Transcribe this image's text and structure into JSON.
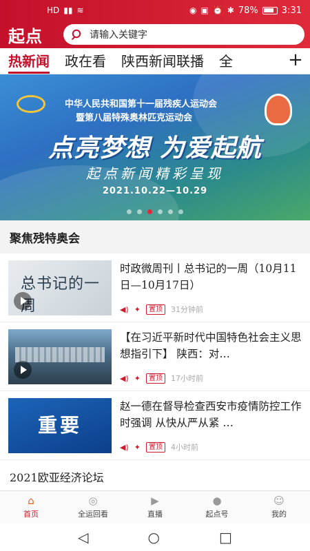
{
  "status_bar": {
    "left_icons": [
      "hd-icon",
      "signal-icon",
      "wifi-icon"
    ],
    "battery": "78%",
    "time": "3:31"
  },
  "app_bar": {
    "logo": "起点",
    "search_placeholder": "请输入关键字"
  },
  "tabs": [
    {
      "label": "热新闻",
      "active": true
    },
    {
      "label": "政在看",
      "active": false
    },
    {
      "label": "陕西新闻联播",
      "active": false
    },
    {
      "label": "全",
      "active": false
    }
  ],
  "banner": {
    "line1": "中华人民共和国第十一届残疾人运动会",
    "line2": "暨第八届特殊奥林匹克运动会",
    "slogan": "点亮梦想 为爱起航",
    "subtitle": "起点新闻精彩呈现",
    "date": "2021.10.22—10.29",
    "dot_count": 6,
    "active_dot": 2
  },
  "section_title": "聚焦残特奥会",
  "news": [
    {
      "thumb_text": "总书记的一周",
      "title": "时政微周刊丨总书记的一周（10月11日—10月17日）",
      "badge": "置顶",
      "time": "31分钟前"
    },
    {
      "thumb_text": "",
      "title": "【在习近平新时代中国特色社会主义思想指引下】 陕西：对…",
      "badge": "置顶",
      "time": "17小时前"
    },
    {
      "thumb_text": "重要",
      "title": "赵一德在督导检查西安市疫情防控工作时强调 从快从严从紧 …",
      "badge": "置顶",
      "time": "4小时前"
    }
  ],
  "next_section": "2021欧亚经济论坛",
  "bottom_nav": [
    {
      "label": "首页",
      "icon": "home-icon",
      "active": true
    },
    {
      "label": "全运回看",
      "icon": "games-icon",
      "active": false
    },
    {
      "label": "直播",
      "icon": "video-icon",
      "active": false
    },
    {
      "label": "起点号",
      "icon": "account-icon",
      "active": false
    },
    {
      "label": "我的",
      "icon": "user-icon",
      "active": false
    }
  ],
  "colors": {
    "brand": "#c4102a",
    "accent": "#d0192b"
  }
}
